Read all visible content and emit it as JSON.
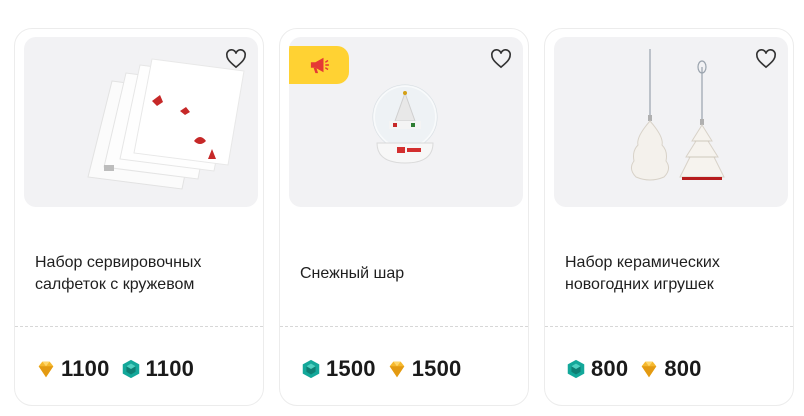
{
  "products": [
    {
      "title": "Набор сервировочных салфеток с кружевом",
      "image": "napkins-set-image",
      "promo": false,
      "prices": [
        {
          "currency": "gold-diamond-icon",
          "value": "1100"
        },
        {
          "currency": "teal-gem-icon",
          "value": "1100"
        }
      ]
    },
    {
      "title": "Снежный шар",
      "image": "snow-globe-image",
      "promo": true,
      "promo_icon": "megaphone-icon",
      "prices": [
        {
          "currency": "teal-gem-icon",
          "value": "1500"
        },
        {
          "currency": "gold-diamond-icon",
          "value": "1500"
        }
      ]
    },
    {
      "title": "Набор керамических новогодних игрушек",
      "image": "ceramic-ornaments-image",
      "promo": false,
      "prices": [
        {
          "currency": "teal-gem-icon",
          "value": "800"
        },
        {
          "currency": "gold-diamond-icon",
          "value": "800"
        }
      ]
    }
  ],
  "colors": {
    "promo_badge": "#ffd233",
    "promo_icon": "#e53935",
    "gold_gem": "#f5b82e",
    "teal_gem": "#13a89a",
    "card_image_bg": "#f2f2f4"
  }
}
